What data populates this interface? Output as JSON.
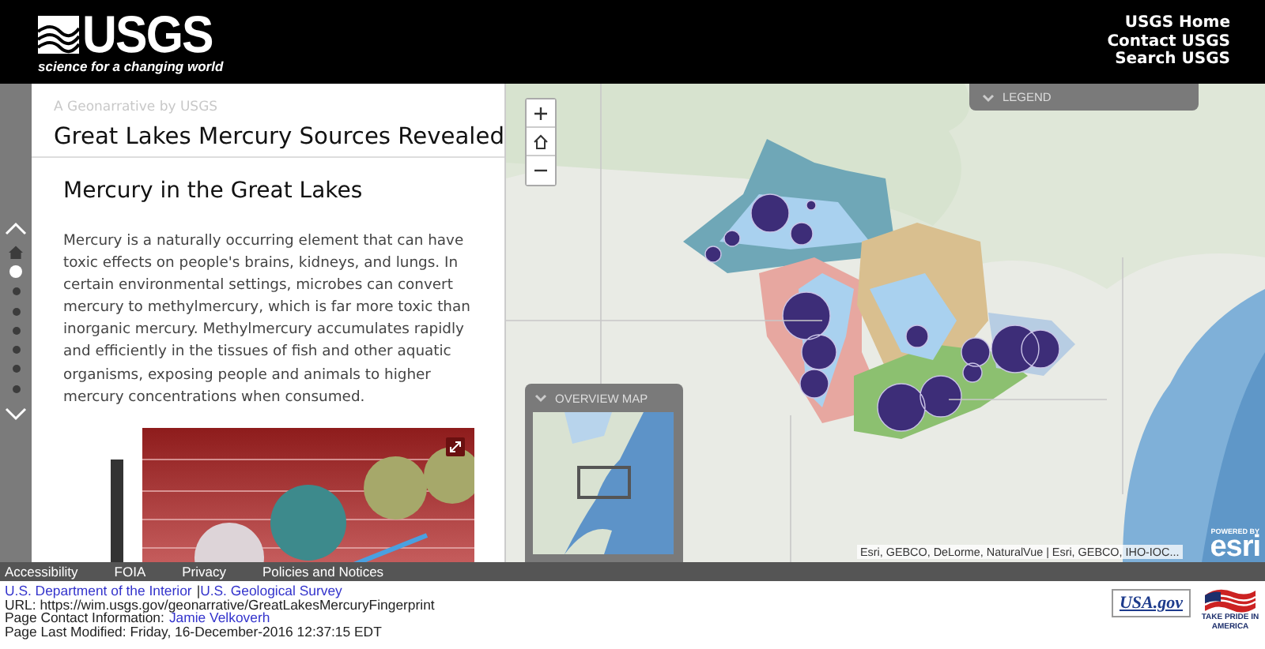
{
  "header": {
    "logo": {
      "wordmark": "USGS",
      "tagline": "science for a changing world"
    },
    "links": [
      "USGS Home",
      "Contact USGS",
      "Search USGS"
    ]
  },
  "story_nav": {
    "items": [
      {
        "kind": "home",
        "selected": false
      },
      {
        "kind": "dot",
        "selected": true
      },
      {
        "kind": "dot",
        "selected": false
      },
      {
        "kind": "dot",
        "selected": false
      },
      {
        "kind": "dot",
        "selected": false
      },
      {
        "kind": "dot",
        "selected": false
      },
      {
        "kind": "dot",
        "selected": false
      },
      {
        "kind": "dot",
        "selected": false
      }
    ]
  },
  "panel": {
    "subtitle": "A Geonarrative by USGS",
    "title": "Great Lakes Mercury Sources Revealed",
    "section_title": "Mercury in the Great Lakes",
    "body": "Mercury is a naturally occurring element that can have toxic effects on people's brains, kidneys, and lungs. In certain environmental settings, microbes can convert mercury to methylmercury, which is far more toxic than inorganic mercury. Methylmercury accumulates rapidly and efficiently in the tissues of fish and other aquatic organisms, exposing people and animals to higher mercury concentrations when consumed."
  },
  "map": {
    "legend": {
      "label": "LEGEND"
    },
    "overview": {
      "label": "OVERVIEW MAP"
    },
    "attribution": "Esri, GEBCO, DeLorme, NaturalVue | Esri, GEBCO, IHO-IOC...",
    "esri": {
      "powered_by": "POWERED BY",
      "wordmark": "esri"
    }
  },
  "footer": {
    "links": [
      "Accessibility",
      "FOIA",
      "Privacy",
      "Policies and Notices"
    ],
    "agency_links": [
      "U.S. Department of the Interior",
      "U.S. Geological Survey"
    ],
    "separator": "|",
    "url": "URL: https://wim.usgs.gov/geonarrative/GreatLakesMercuryFingerprint",
    "contact_label": "Page Contact Information:",
    "contact_name": "Jamie Velkoverh",
    "modified": "Page Last Modified: Friday, 16-December-2016 12:37:15 EDT",
    "badges": [
      {
        "kind": "usagov",
        "label": "USA.gov"
      },
      {
        "kind": "pride",
        "label": "TAKE PRIDE IN AMERICA"
      }
    ]
  }
}
